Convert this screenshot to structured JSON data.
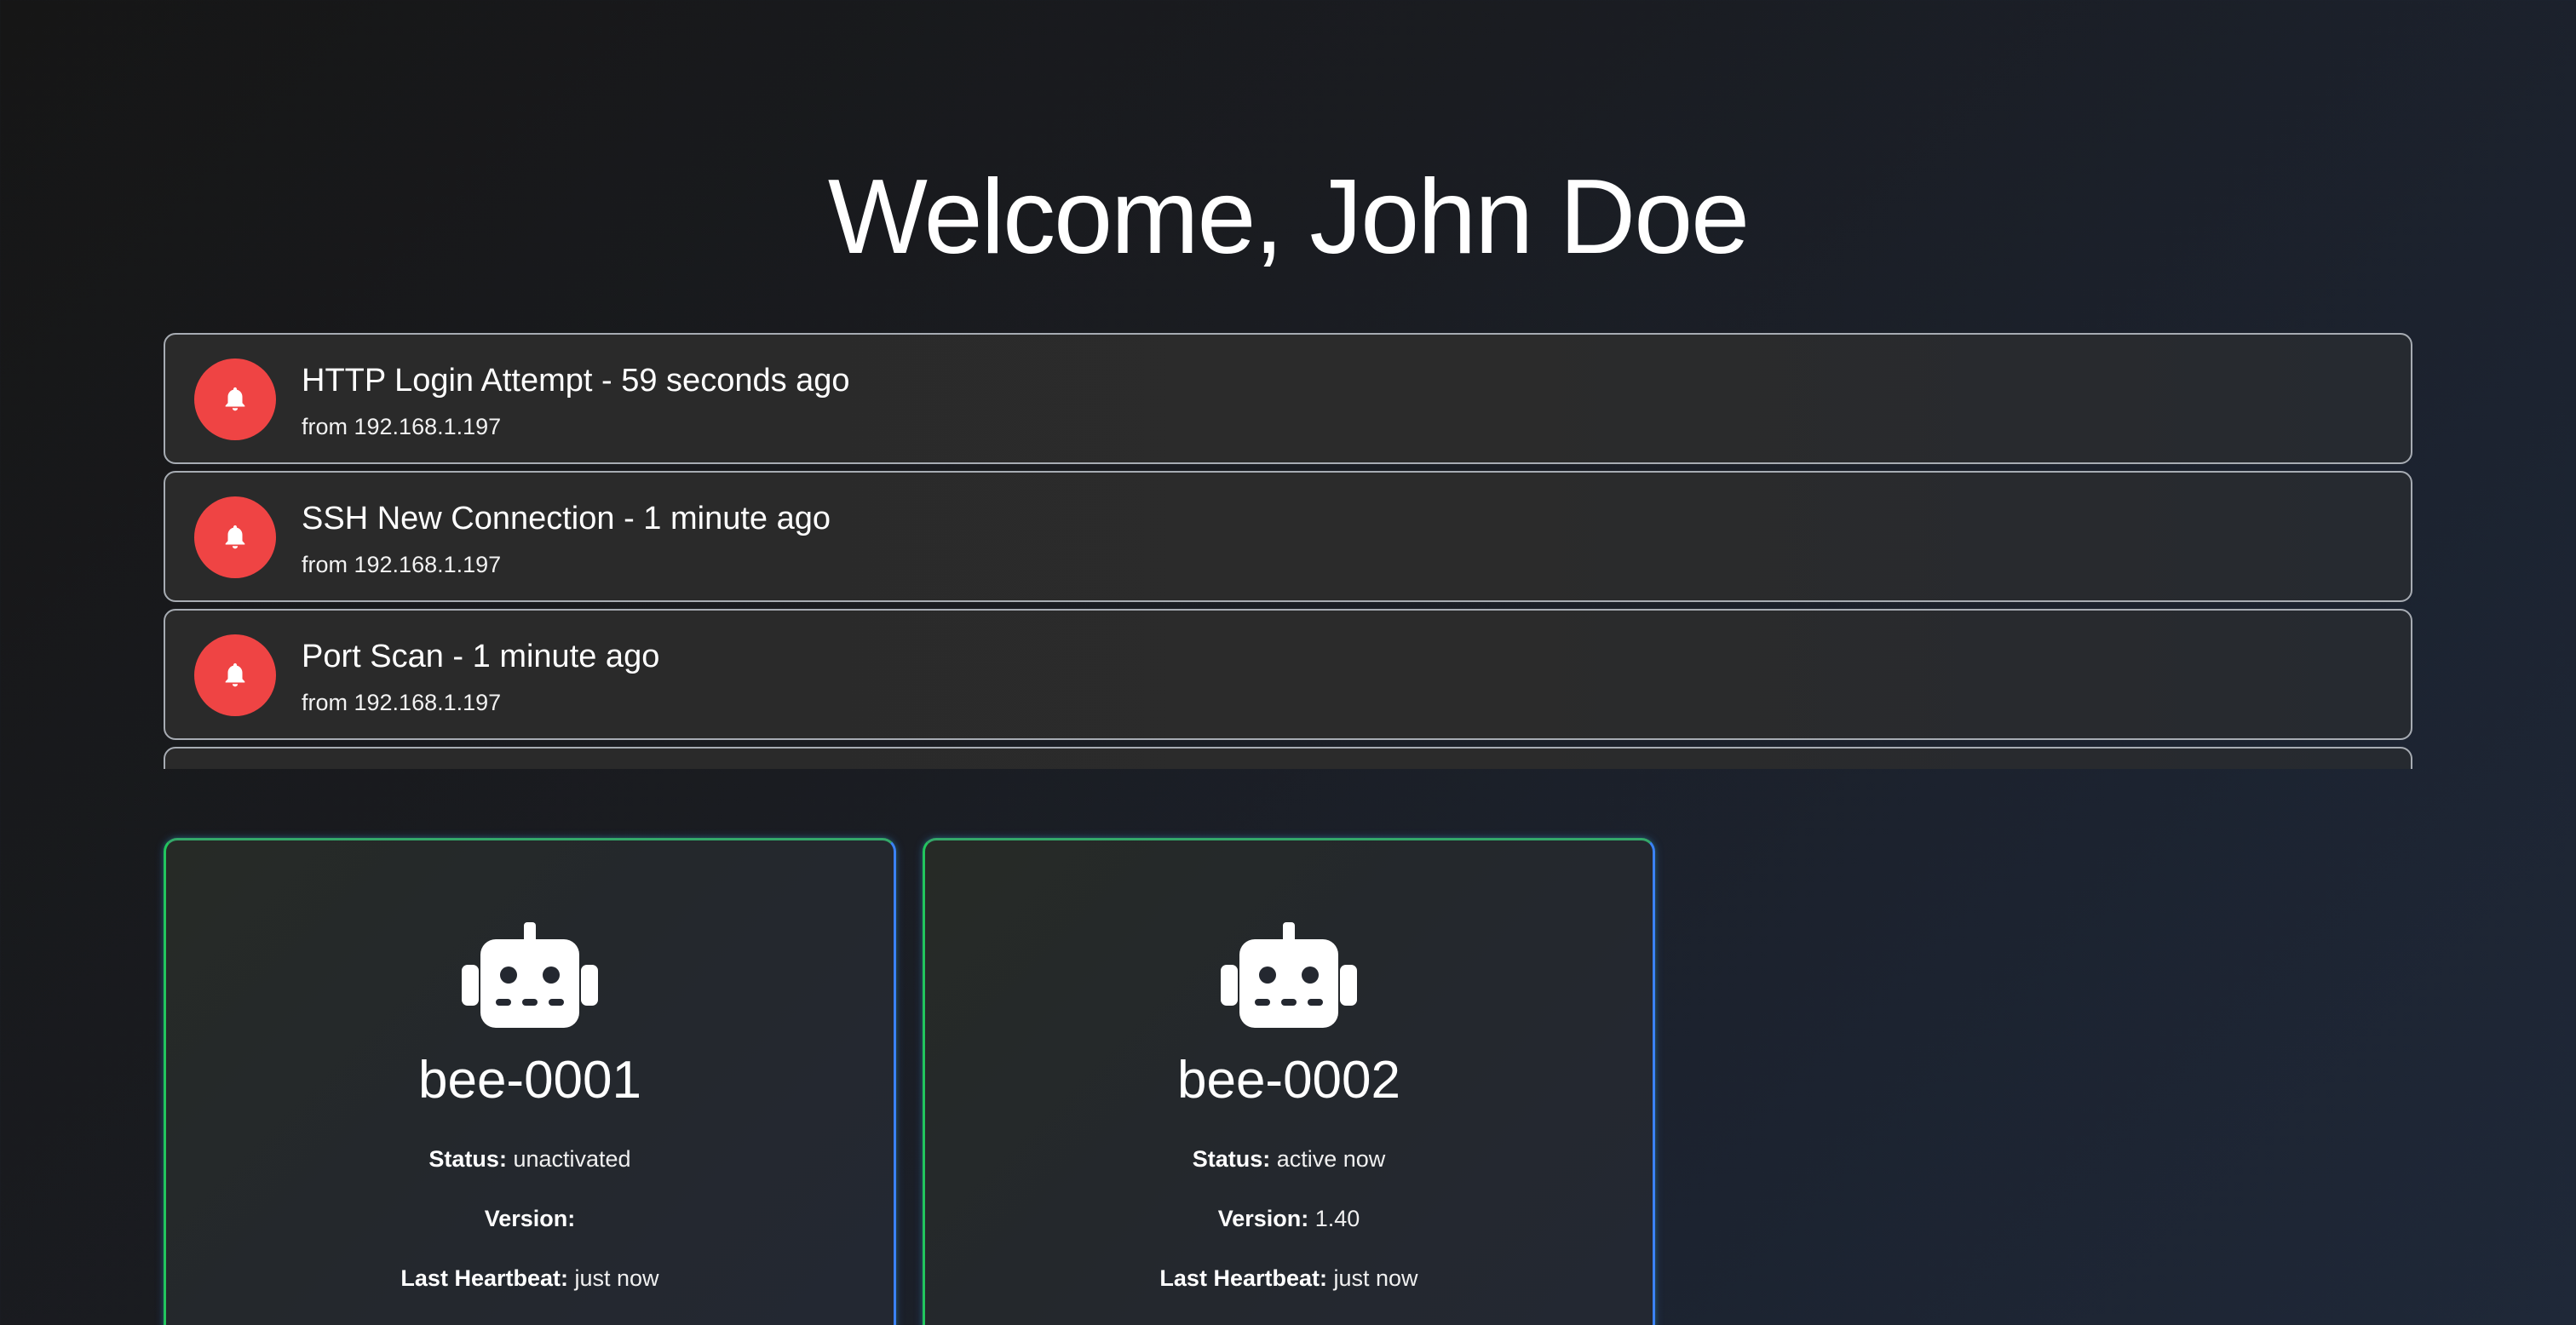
{
  "header": {
    "title": "Welcome, John Doe"
  },
  "alerts": [
    {
      "title": "HTTP Login Attempt - 59 seconds ago",
      "source": "from 192.168.1.197",
      "icon": "bell-icon",
      "icon_color": "#ef4444"
    },
    {
      "title": "SSH New Connection - 1 minute ago",
      "source": "from 192.168.1.197",
      "icon": "bell-icon",
      "icon_color": "#ef4444"
    },
    {
      "title": "Port Scan - 1 minute ago",
      "source": "from 192.168.1.197",
      "icon": "bell-icon",
      "icon_color": "#ef4444"
    }
  ],
  "labels": {
    "status": "Status:",
    "version": "Version:",
    "last_heartbeat": "Last Heartbeat:"
  },
  "agents": [
    {
      "name": "bee-0001",
      "icon": "robot-icon",
      "status": "unactivated",
      "version": "",
      "last_heartbeat": "just now"
    },
    {
      "name": "bee-0002",
      "icon": "robot-icon",
      "status": "active now",
      "version": "1.40",
      "last_heartbeat": "just now"
    }
  ],
  "colors": {
    "alert_accent": "#ef4444",
    "card_border_blue": "#3b82f6",
    "card_border_green": "#22c55e"
  }
}
